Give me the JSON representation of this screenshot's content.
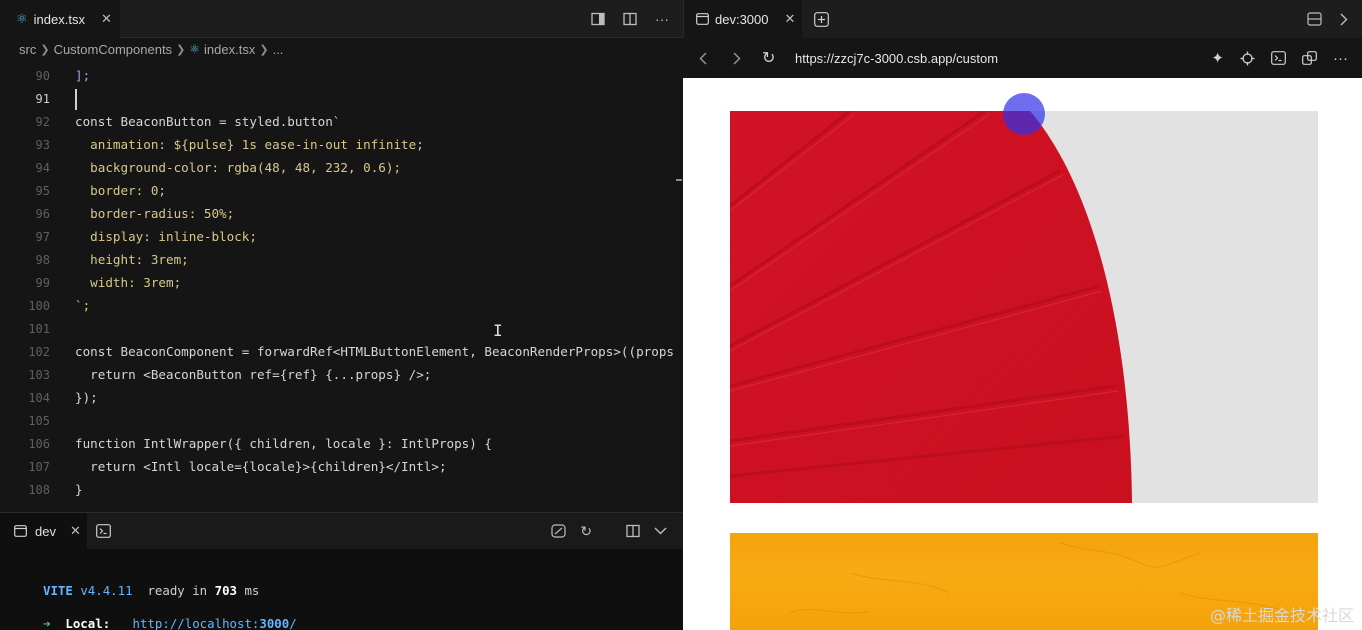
{
  "editor": {
    "tab_label": "index.tsx",
    "breadcrumb": [
      "src",
      "CustomComponents",
      "index.tsx",
      "..."
    ],
    "lines": [
      {
        "num": "90",
        "code": "];"
      },
      {
        "num": "91",
        "code": ""
      },
      {
        "num": "92",
        "code": "const BeaconButton = styled.button`"
      },
      {
        "num": "93",
        "code": "  animation: ${pulse} 1s ease-in-out infinite;"
      },
      {
        "num": "94",
        "code": "  background-color: rgba(48, 48, 232, 0.6);"
      },
      {
        "num": "95",
        "code": "  border: 0;"
      },
      {
        "num": "96",
        "code": "  border-radius: 50%;"
      },
      {
        "num": "97",
        "code": "  display: inline-block;"
      },
      {
        "num": "98",
        "code": "  height: 3rem;"
      },
      {
        "num": "99",
        "code": "  width: 3rem;"
      },
      {
        "num": "100",
        "code": "`;"
      },
      {
        "num": "101",
        "code": ""
      },
      {
        "num": "102",
        "code": "const BeaconComponent = forwardRef<HTMLButtonElement, BeaconRenderProps>((props"
      },
      {
        "num": "103",
        "code": "  return <BeaconButton ref={ref} {...props} />;"
      },
      {
        "num": "104",
        "code": "});"
      },
      {
        "num": "105",
        "code": ""
      },
      {
        "num": "106",
        "code": "function IntlWrapper({ children, locale }: IntlProps) {"
      },
      {
        "num": "107",
        "code": "  return <Intl locale={locale}>{children}</Intl>;"
      },
      {
        "num": "108",
        "code": "}"
      }
    ]
  },
  "terminal": {
    "tab_label": "dev",
    "vite": "VITE",
    "version": "v4.4.11",
    "ready_text": "ready in",
    "ready_ms": "703",
    "ms_unit": "ms",
    "arrow": "➜",
    "local_label": "Local:",
    "local_url_prefix": "http://localhost:",
    "local_port": "3000",
    "local_url_suffix": "/"
  },
  "browser": {
    "tab_label": "dev:3000",
    "url": "https://zzcj7c-3000.csb.app/custom",
    "beacon_color": "#3030e8"
  },
  "watermark": "@稀土掘金技术社区"
}
